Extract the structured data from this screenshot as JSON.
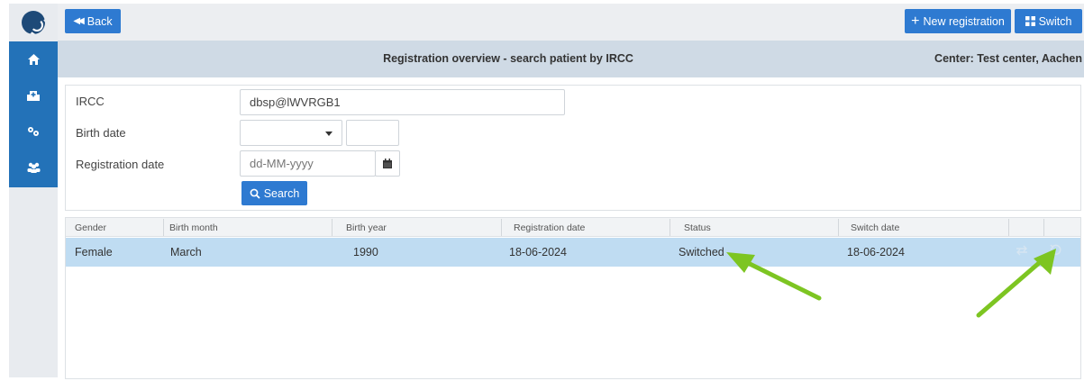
{
  "sidebar": {
    "items": [
      {
        "icon": "home-icon"
      },
      {
        "icon": "hospital-icon"
      },
      {
        "icon": "cogs-icon"
      },
      {
        "icon": "users-icon"
      }
    ]
  },
  "toolbar": {
    "back_label": "Back",
    "new_registration_label": "New registration",
    "switch_label": "Switch"
  },
  "header": {
    "title": "Registration overview - search patient by IRCC",
    "center": "Center: Test center, Aachen"
  },
  "search": {
    "ircc_label": "IRCC",
    "ircc_value": "dbsp@lWVRGB1",
    "birth_date_label": "Birth date",
    "birth_month_value": "",
    "birth_year_value": "",
    "registration_date_label": "Registration date",
    "registration_date_placeholder": "dd-MM-yyyy",
    "search_label": "Search"
  },
  "table": {
    "headers": [
      "Gender",
      "Birth month",
      "Birth year",
      "Registration date",
      "Status",
      "Switch date"
    ],
    "rows": [
      {
        "gender": "Female",
        "birth_month": "March",
        "birth_year": "1990",
        "registration_date": "18-06-2024",
        "status": "Switched",
        "switch_date": "18-06-2024",
        "actions": [
          "switch-icon",
          "undo-icon"
        ]
      }
    ]
  },
  "annotations": {
    "arrow_color": "#7dc522"
  },
  "colors": {
    "primary": "#2e7ad1",
    "sidebar_active": "#2372b8",
    "title_bar": "#cfdae5",
    "selected_row": "#bfdcf2"
  }
}
